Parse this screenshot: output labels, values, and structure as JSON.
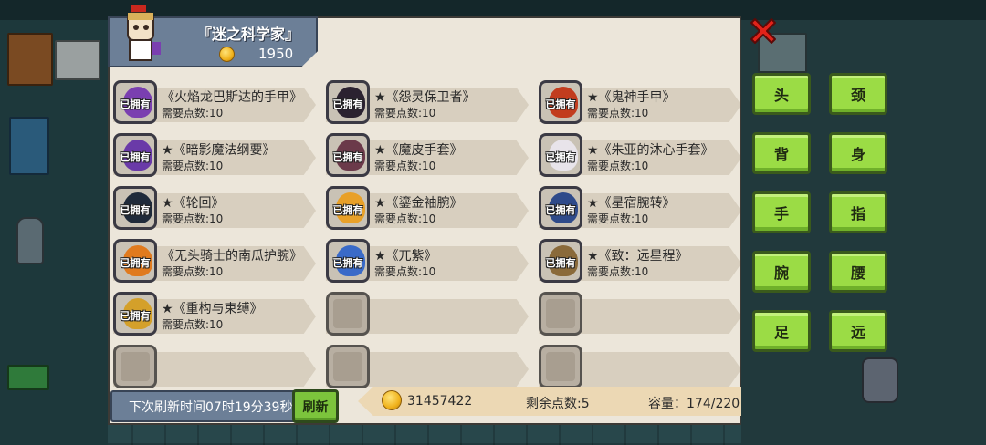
{
  "merchant": {
    "name": "『迷之科学家』",
    "price": "1950"
  },
  "owned_text": "已拥有",
  "items": [
    {
      "name": "《火焰龙巴斯达的手甲》",
      "cost": "需要点数:10",
      "owned": true,
      "color": "#7a3fb0"
    },
    {
      "name": "★《怨灵保卫者》",
      "cost": "需要点数:10",
      "owned": true,
      "color": "#2b2230"
    },
    {
      "name": "★《鬼神手甲》",
      "cost": "需要点数:10",
      "owned": true,
      "color": "#c23c1e"
    },
    {
      "name": "★《暗影魔法纲要》",
      "cost": "需要点数:10",
      "owned": true,
      "color": "#6a3aa8"
    },
    {
      "name": "★《魔皮手套》",
      "cost": "需要点数:10",
      "owned": true,
      "color": "#6b3a4a"
    },
    {
      "name": "★《朱亚的沐心手套》",
      "cost": "需要点数:10",
      "owned": true,
      "color": "#e8e4ea"
    },
    {
      "name": "★《轮回》",
      "cost": "需要点数:10",
      "owned": true,
      "color": "#1f2a3a"
    },
    {
      "name": "★《鎏金袖腕》",
      "cost": "需要点数:10",
      "owned": true,
      "color": "#e8a028"
    },
    {
      "name": "★《星宿腕转》",
      "cost": "需要点数:10",
      "owned": true,
      "color": "#2e4a8a"
    },
    {
      "name": "《无头骑士的南瓜护腕》",
      "cost": "需要点数:10",
      "owned": true,
      "color": "#e07a1e"
    },
    {
      "name": "★《兀紫》",
      "cost": "需要点数:10",
      "owned": true,
      "color": "#3a6ac8"
    },
    {
      "name": "★《致：远星程》",
      "cost": "需要点数:10",
      "owned": true,
      "color": "#8a6a3a"
    },
    {
      "name": "★《重构与束缚》",
      "cost": "需要点数:10",
      "owned": true,
      "color": "#d4a02a"
    },
    {
      "name": "",
      "cost": "",
      "owned": false,
      "color": ""
    },
    {
      "name": "",
      "cost": "",
      "owned": false,
      "color": ""
    },
    {
      "name": "",
      "cost": "",
      "owned": false,
      "color": ""
    },
    {
      "name": "",
      "cost": "",
      "owned": false,
      "color": ""
    },
    {
      "name": "",
      "cost": "",
      "owned": false,
      "color": ""
    }
  ],
  "footer": {
    "refresh_time": "下次刷新时间07时19分39秒",
    "refresh_button": "刷新",
    "gold": "31457422",
    "points_remaining": "剩余点数:5",
    "capacity": "容量：174/220"
  },
  "slots": [
    "头",
    "颈",
    "背",
    "身",
    "手",
    "指",
    "腕",
    "腰",
    "足",
    "远"
  ],
  "colors": {
    "panel": "#ece6da",
    "slot_button": "#9bdc45",
    "close": "#e2231a",
    "header": "#6c7f97"
  }
}
